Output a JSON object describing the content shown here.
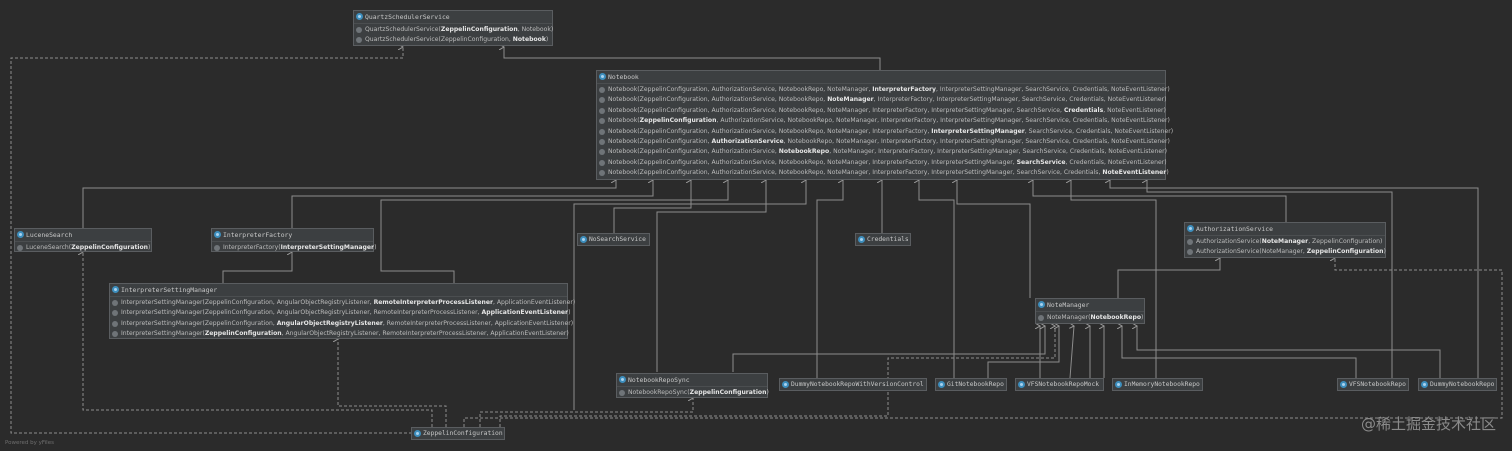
{
  "footer": "Powered by yFiles",
  "watermark": "@稀土掘金技术社区",
  "nodes": {
    "quartz": {
      "title": "QuartzSchedulerService",
      "rows": [
        {
          "pre": "QuartzSchedulerService(",
          "bold": "ZeppelinConfiguration",
          "post": ", Notebook)"
        },
        {
          "pre": "QuartzSchedulerService(ZeppelinConfiguration, ",
          "bold": "Notebook",
          "post": ")"
        }
      ]
    },
    "notebook": {
      "title": "Notebook",
      "rows": [
        {
          "pre": "Notebook(ZeppelinConfiguration, AuthorizationService, NotebookRepo, NoteManager, ",
          "bold": "InterpreterFactory",
          "post": ", InterpreterSettingManager, SearchService, Credentials, NoteEventListener)"
        },
        {
          "pre": "Notebook(ZeppelinConfiguration, AuthorizationService, NotebookRepo, ",
          "bold": "NoteManager",
          "post": ", InterpreterFactory, InterpreterSettingManager, SearchService, Credentials, NoteEventListener)"
        },
        {
          "pre": "Notebook(ZeppelinConfiguration, AuthorizationService, NotebookRepo, NoteManager, InterpreterFactory, InterpreterSettingManager, SearchService, ",
          "bold": "Credentials",
          "post": ", NoteEventListener)"
        },
        {
          "pre": "Notebook(",
          "bold": "ZeppelinConfiguration",
          "post": ", AuthorizationService, NotebookRepo, NoteManager, InterpreterFactory, InterpreterSettingManager, SearchService, Credentials, NoteEventListener)"
        },
        {
          "pre": "Notebook(ZeppelinConfiguration, AuthorizationService, NotebookRepo, NoteManager, InterpreterFactory, ",
          "bold": "InterpreterSettingManager",
          "post": ", SearchService, Credentials, NoteEventListener)"
        },
        {
          "pre": "Notebook(ZeppelinConfiguration, ",
          "bold": "AuthorizationService",
          "post": ", NotebookRepo, NoteManager, InterpreterFactory, InterpreterSettingManager, SearchService, Credentials, NoteEventListener)"
        },
        {
          "pre": "Notebook(ZeppelinConfiguration, AuthorizationService, ",
          "bold": "NotebookRepo",
          "post": ", NoteManager, InterpreterFactory, InterpreterSettingManager, SearchService, Credentials, NoteEventListener)"
        },
        {
          "pre": "Notebook(ZeppelinConfiguration, AuthorizationService, NotebookRepo, NoteManager, InterpreterFactory, InterpreterSettingManager, ",
          "bold": "SearchService",
          "post": ", Credentials, NoteEventListener)"
        },
        {
          "pre": "Notebook(ZeppelinConfiguration, AuthorizationService, NotebookRepo, NoteManager, InterpreterFactory, InterpreterSettingManager, SearchService, Credentials, ",
          "bold": "NoteEventListener",
          "post": ")"
        }
      ]
    },
    "lucene": {
      "title": "LuceneSearch",
      "rows": [
        {
          "pre": "LuceneSearch(",
          "bold": "ZeppelinConfiguration",
          "post": ")"
        }
      ]
    },
    "interpFactory": {
      "title": "InterpreterFactory",
      "rows": [
        {
          "pre": "InterpreterFactory(",
          "bold": "InterpreterSettingManager",
          "post": ")"
        }
      ]
    },
    "authService": {
      "title": "AuthorizationService",
      "rows": [
        {
          "pre": "AuthorizationService(",
          "bold": "NoteManager",
          "post": ", ZeppelinConfiguration)"
        },
        {
          "pre": "AuthorizationService(NoteManager, ",
          "bold": "ZeppelinConfiguration",
          "post": ")"
        }
      ]
    },
    "ism": {
      "title": "InterpreterSettingManager",
      "rows": [
        {
          "pre": "InterpreterSettingManager(ZeppelinConfiguration, AngularObjectRegistryListener, ",
          "bold": "RemoteInterpreterProcessListener",
          "post": ", ApplicationEventListener)"
        },
        {
          "pre": "InterpreterSettingManager(ZeppelinConfiguration, AngularObjectRegistryListener, RemoteInterpreterProcessListener, ",
          "bold": "ApplicationEventListener",
          "post": ")"
        },
        {
          "pre": "InterpreterSettingManager(ZeppelinConfiguration, ",
          "bold": "AngularObjectRegistryListener",
          "post": ", RemoteInterpreterProcessListener, ApplicationEventListener)"
        },
        {
          "pre": "InterpreterSettingManager(",
          "bold": "ZeppelinConfiguration",
          "post": ", AngularObjectRegistryListener, RemoteInterpreterProcessListener, ApplicationEventListener)"
        }
      ]
    },
    "noteManager": {
      "title": "NoteManager",
      "rows": [
        {
          "pre": "NoteManager(",
          "bold": "NotebookRepo",
          "post": ")"
        }
      ]
    },
    "repoSync": {
      "title": "NotebookRepoSync",
      "rows": [
        {
          "pre": "NotebookRepoSync(",
          "bold": "ZeppelinConfiguration",
          "post": ")"
        }
      ]
    }
  },
  "simple": {
    "noSearch": "NoSearchService",
    "credentials": "Credentials",
    "dummyVC": "DummyNotebookRepoWithVersionControl",
    "git": "GitNotebookRepo",
    "vfsMock": "VFSNotebookRepoMock",
    "inMemory": "InMemoryNotebookRepo",
    "vfs": "VFSNotebookRepo",
    "dummy": "DummyNotebookRepo",
    "zconf": "ZeppelinConfiguration"
  }
}
